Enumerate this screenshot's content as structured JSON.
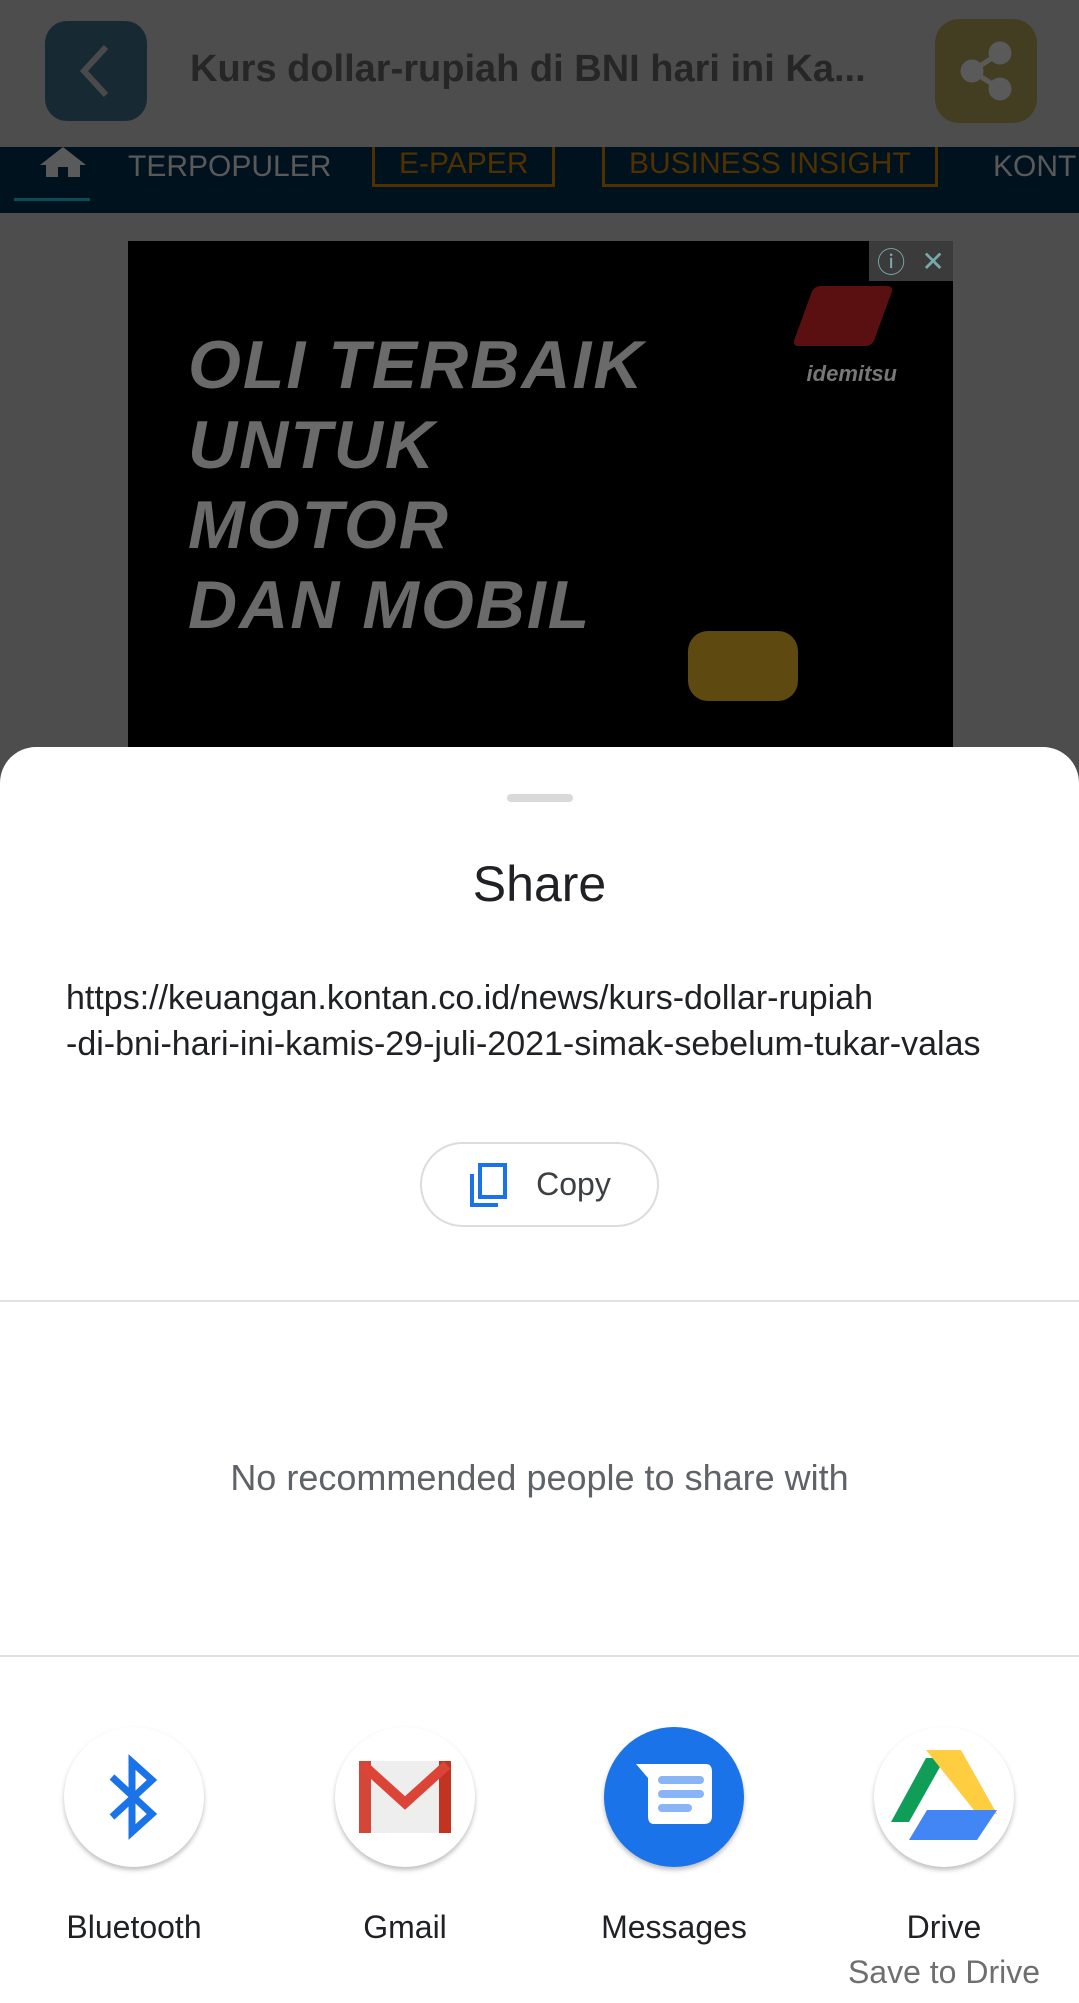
{
  "header": {
    "title": "Kurs dollar-rupiah di BNI hari ini Ka..."
  },
  "nav": {
    "items": [
      "TERPOPULER",
      "E-PAPER",
      "BUSINESS INSIGHT",
      "KONT"
    ]
  },
  "ad": {
    "lines": [
      "OLI TERBAIK",
      "UNTUK",
      "MOTOR",
      "DAN MOBIL"
    ],
    "brand": "idemitsu"
  },
  "share_sheet": {
    "title": "Share",
    "url_line1": "https://keuangan.kontan.co.id/news/kurs-dollar-rupiah",
    "url_line2": "-di-bni-hari-ini-kamis-29-juli-2021-simak-sebelum-tukar-valas",
    "copy_label": "Copy",
    "no_recommend": "No recommended people to share with",
    "apps": [
      {
        "label": "Bluetooth",
        "icon": "bluetooth-icon"
      },
      {
        "label": "Gmail",
        "icon": "gmail-icon"
      },
      {
        "label": "Messages",
        "icon": "messages-icon"
      },
      {
        "label": "Drive",
        "sublabel": "Save to Drive",
        "icon": "drive-icon"
      }
    ]
  }
}
